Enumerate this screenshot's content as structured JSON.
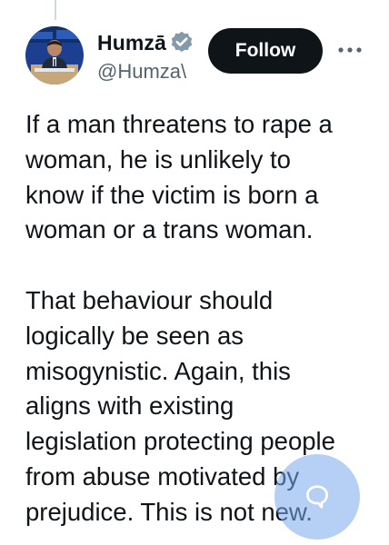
{
  "author": {
    "display_name": "Humzā",
    "handle": "@Humza\\",
    "verified": true
  },
  "actions": {
    "follow_label": "Follow",
    "more_icon": "more-horizontal-icon"
  },
  "tweet": {
    "paragraph_1": [
      "If a man threatens to rape a",
      "woman, he is unlikely to",
      "know if the victim is born a",
      "woman or a trans woman."
    ],
    "paragraph_2": [
      "That behaviour should",
      "logically be seen as",
      "misogynistic. Again, this",
      "aligns with existing",
      "legislation protecting people",
      "from abuse motivated by",
      "prejudice. This is not new."
    ]
  },
  "floating_button": {
    "icon": "reply-bubble-icon"
  },
  "colors": {
    "text": "#0f1419",
    "secondary_text": "#536471",
    "follow_bg": "#0f1419",
    "verified": "#829aab",
    "fab_bg": "#78aaeb"
  }
}
